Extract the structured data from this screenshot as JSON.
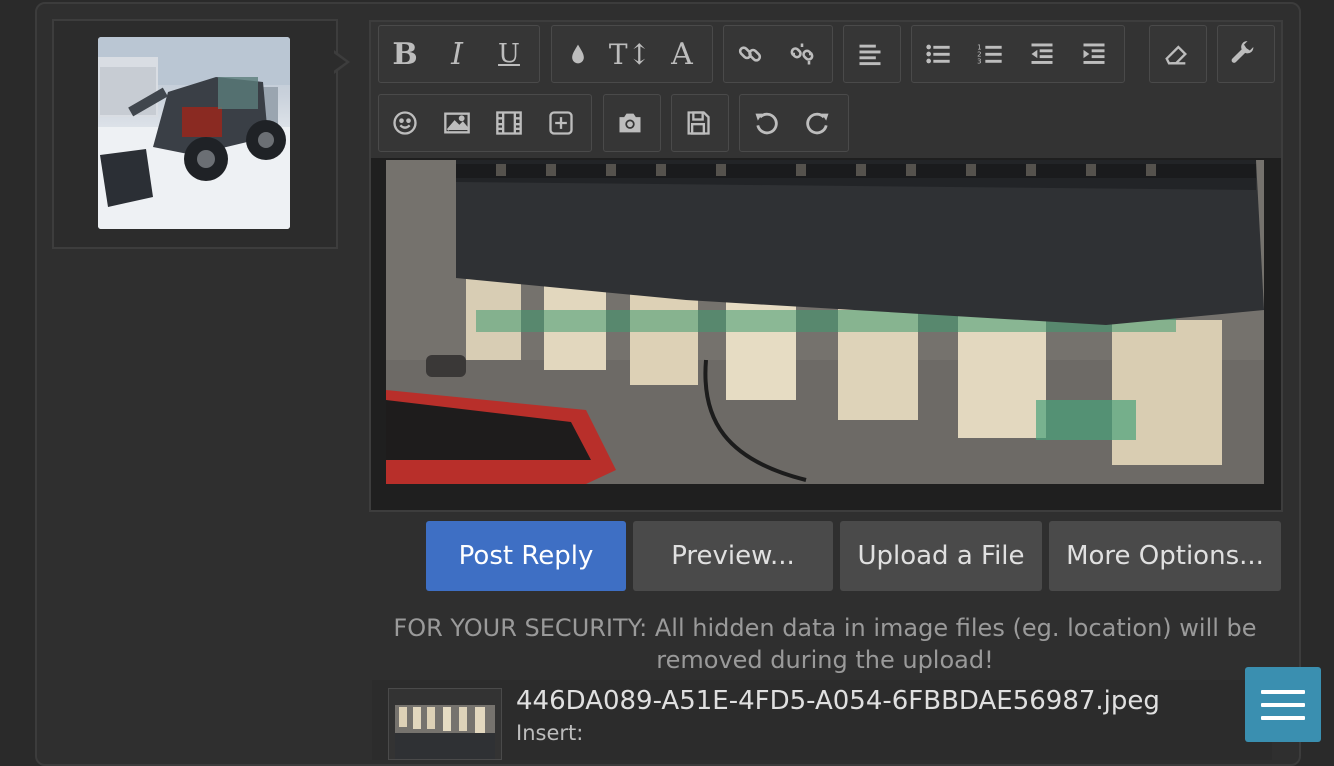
{
  "toolbar": {
    "groups": [
      {
        "buttons": [
          {
            "icon": "bold-icon",
            "glyph": "B"
          },
          {
            "icon": "italic-icon",
            "glyph": "I"
          },
          {
            "icon": "underline-icon",
            "glyph": "U"
          }
        ]
      },
      {
        "buttons": [
          {
            "icon": "text-color-icon"
          },
          {
            "icon": "font-size-icon",
            "glyph": "T↕"
          },
          {
            "icon": "font-family-icon",
            "glyph": "A"
          }
        ]
      },
      {
        "buttons": [
          {
            "icon": "link-icon"
          },
          {
            "icon": "unlink-icon"
          }
        ]
      },
      {
        "buttons": [
          {
            "icon": "align-icon"
          }
        ]
      },
      {
        "buttons": [
          {
            "icon": "bullet-list-icon"
          },
          {
            "icon": "numbered-list-icon"
          },
          {
            "icon": "outdent-icon"
          },
          {
            "icon": "indent-icon"
          }
        ]
      },
      {
        "buttons": [
          {
            "icon": "remove-format-icon"
          }
        ]
      },
      {
        "buttons": [
          {
            "icon": "settings-wrench-icon"
          }
        ]
      },
      {
        "buttons": [
          {
            "icon": "smilie-icon"
          },
          {
            "icon": "image-icon"
          },
          {
            "icon": "media-icon"
          },
          {
            "icon": "insert-icon"
          }
        ]
      },
      {
        "buttons": [
          {
            "icon": "camera-icon"
          }
        ]
      },
      {
        "buttons": [
          {
            "icon": "save-draft-icon"
          }
        ]
      },
      {
        "buttons": [
          {
            "icon": "undo-icon"
          },
          {
            "icon": "redo-icon"
          }
        ]
      }
    ]
  },
  "actions": {
    "post_reply": "Post Reply",
    "preview": "Preview...",
    "upload": "Upload a File",
    "more_options": "More Options..."
  },
  "security_note": "FOR YOUR SECURITY: All hidden data in image files (eg. location) will be removed during the upload!",
  "attachment": {
    "filename": "446DA089-A51E-4FD5-A054-6FBBDAE56987.jpeg",
    "insert_label": "Insert:"
  },
  "colors": {
    "primary": "#3e6fc4",
    "fab": "#3a8fb0"
  }
}
